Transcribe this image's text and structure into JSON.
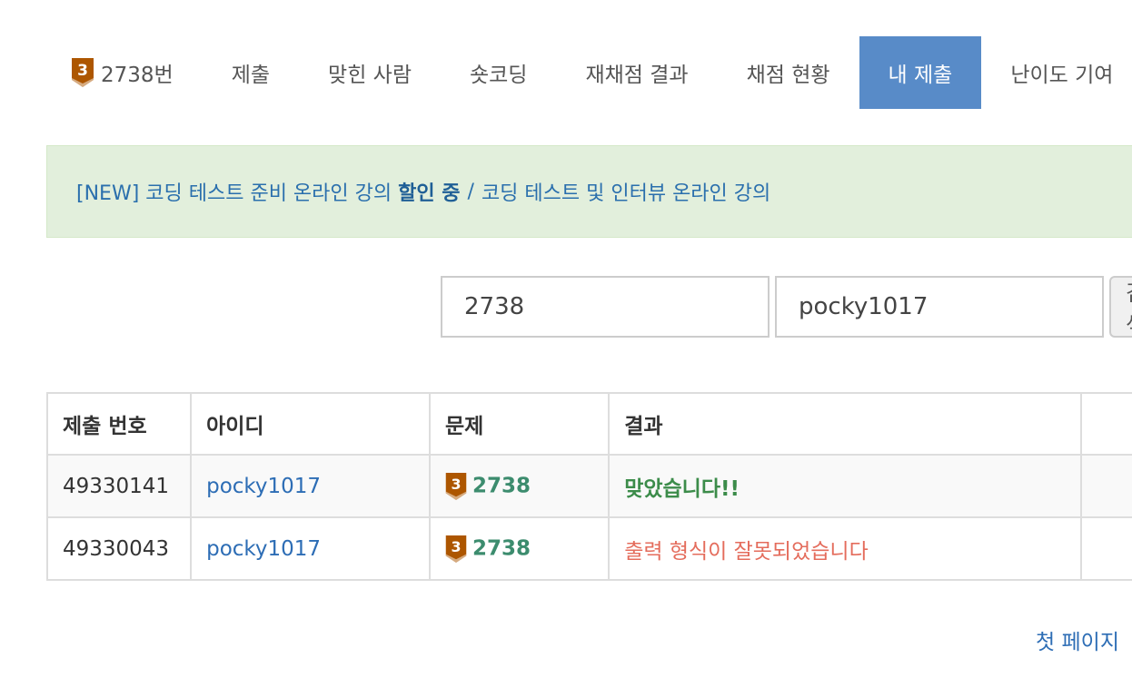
{
  "tabs": {
    "problem_tier": "3",
    "problem_label": "2738번",
    "submit": "제출",
    "solved_users": "맞힌 사람",
    "short_coding": "숏코딩",
    "rejudge_results": "재채점 결과",
    "judge_status": "채점 현황",
    "my_submissions": "내 제출",
    "difficulty": "난이도 기여"
  },
  "notice": {
    "prefix": "[NEW] 코딩 테스트 준비 온라인 강의",
    "highlight": "할인 중",
    "separator": "/",
    "second": "코딩 테스트 및 인터뷰 온라인 강의"
  },
  "search": {
    "problem_value": "2738",
    "user_value": "pocky1017",
    "button_label": "검색"
  },
  "table": {
    "headers": [
      "제출 번호",
      "아이디",
      "문제",
      "결과"
    ],
    "rows": [
      {
        "submission_id": "49330141",
        "user": "pocky1017",
        "tier": "3",
        "problem": "2738",
        "result": "맞았습니다!!"
      },
      {
        "submission_id": "49330043",
        "user": "pocky1017",
        "tier": "3",
        "problem": "2738",
        "result": "출력 형식이 잘못되었습니다"
      }
    ]
  },
  "pagination": {
    "first_page": "첫 페이지"
  },
  "colors": {
    "active_tab": "#588bc8",
    "tier_bronze": "#ad5600",
    "accepted": "#3c8c4a",
    "presentation_error": "#e46c5c",
    "link": "#2d6db5"
  }
}
